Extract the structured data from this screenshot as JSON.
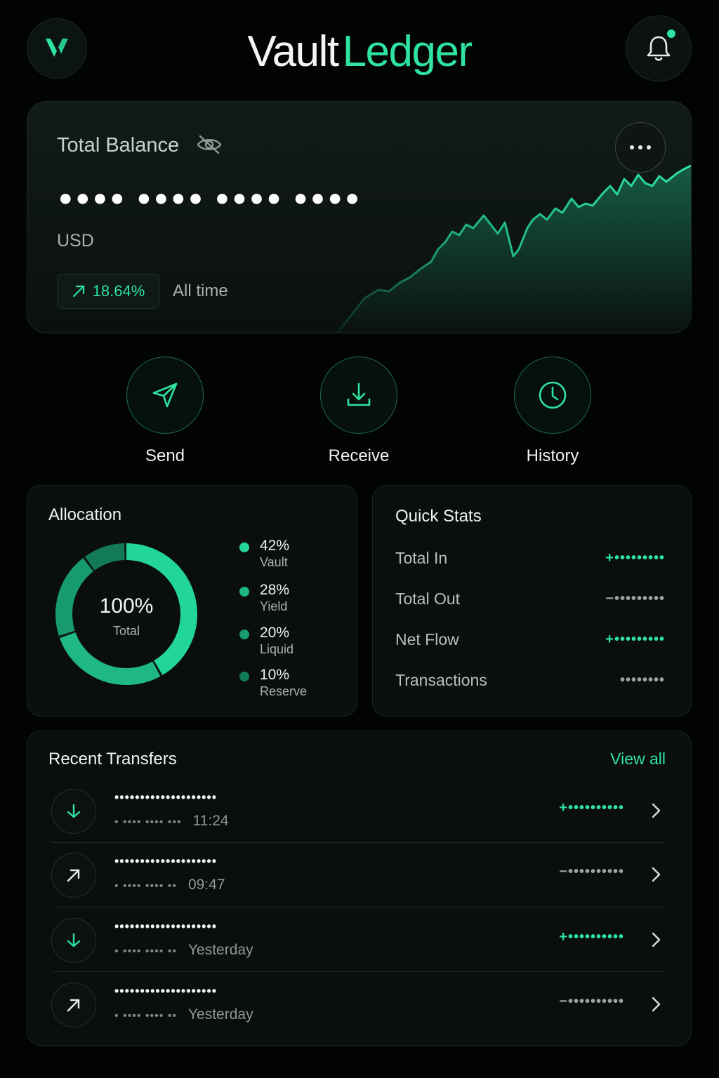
{
  "header": {
    "brand_part1": "Vault",
    "brand_part2": "Ledger",
    "logo_icon": "v-logo-icon",
    "bell_icon": "bell-icon",
    "has_notification": true
  },
  "balance": {
    "title": "Total Balance",
    "masked_value": "●●●● ●●●● ●●●● ●●●●",
    "currency": "USD",
    "change_pct": "18.64%",
    "period": "All time",
    "hidden_icon": "eye-off-icon",
    "more_icon": "more-icon"
  },
  "actions": [
    {
      "label": "Send",
      "icon": "send-icon"
    },
    {
      "label": "Receive",
      "icon": "receive-icon"
    },
    {
      "label": "History",
      "icon": "clock-icon"
    }
  ],
  "allocation": {
    "title": "Allocation",
    "center_value": "100%",
    "center_label": "Total",
    "segments": [
      {
        "pct": "42%",
        "name": "Vault",
        "value": 42,
        "color": "#22d69a"
      },
      {
        "pct": "28%",
        "name": "Yield",
        "value": 28,
        "color": "#1fb883"
      },
      {
        "pct": "20%",
        "name": "Liquid",
        "value": 20,
        "color": "#179a6d"
      },
      {
        "pct": "10%",
        "name": "Reserve",
        "value": 10,
        "color": "#127a57"
      }
    ]
  },
  "quick_stats": {
    "title": "Quick Stats",
    "rows": [
      {
        "label": "Total In",
        "value": "+•••••••••",
        "tone": "positive"
      },
      {
        "label": "Total Out",
        "value": "−•••••••••",
        "tone": "neutral"
      },
      {
        "label": "Net Flow",
        "value": "+•••••••••",
        "tone": "positive"
      },
      {
        "label": "Transactions",
        "value": "••••••••",
        "tone": "neutral"
      }
    ]
  },
  "transfers": {
    "title": "Recent Transfers",
    "view_all": "View all",
    "items": [
      {
        "direction": "in",
        "icon": "arrow-down-icon",
        "name": "••••••••••••••••••••",
        "meta": "• •••• •••• •••",
        "time": "11:24",
        "amount": "+••••••••••"
      },
      {
        "direction": "out",
        "icon": "arrow-up-right-icon",
        "name": "••••••••••••••••••••",
        "meta": "• •••• •••• ••",
        "time": "09:47",
        "amount": "−••••••••••"
      },
      {
        "direction": "in",
        "icon": "arrow-down-icon",
        "name": "••••••••••••••••••••",
        "meta": "• •••• •••• ••",
        "time": "Yesterday",
        "amount": "+••••••••••"
      },
      {
        "direction": "out",
        "icon": "arrow-up-right-icon",
        "name": "••••••••••••••••••••",
        "meta": "• •••• •••• ••",
        "time": "Yesterday",
        "amount": "−••••••••••"
      }
    ]
  },
  "colors": {
    "accent": "#2fe3a0",
    "background": "#020303",
    "panel": "#0a0e0e",
    "muted_text": "#a9b2af"
  }
}
